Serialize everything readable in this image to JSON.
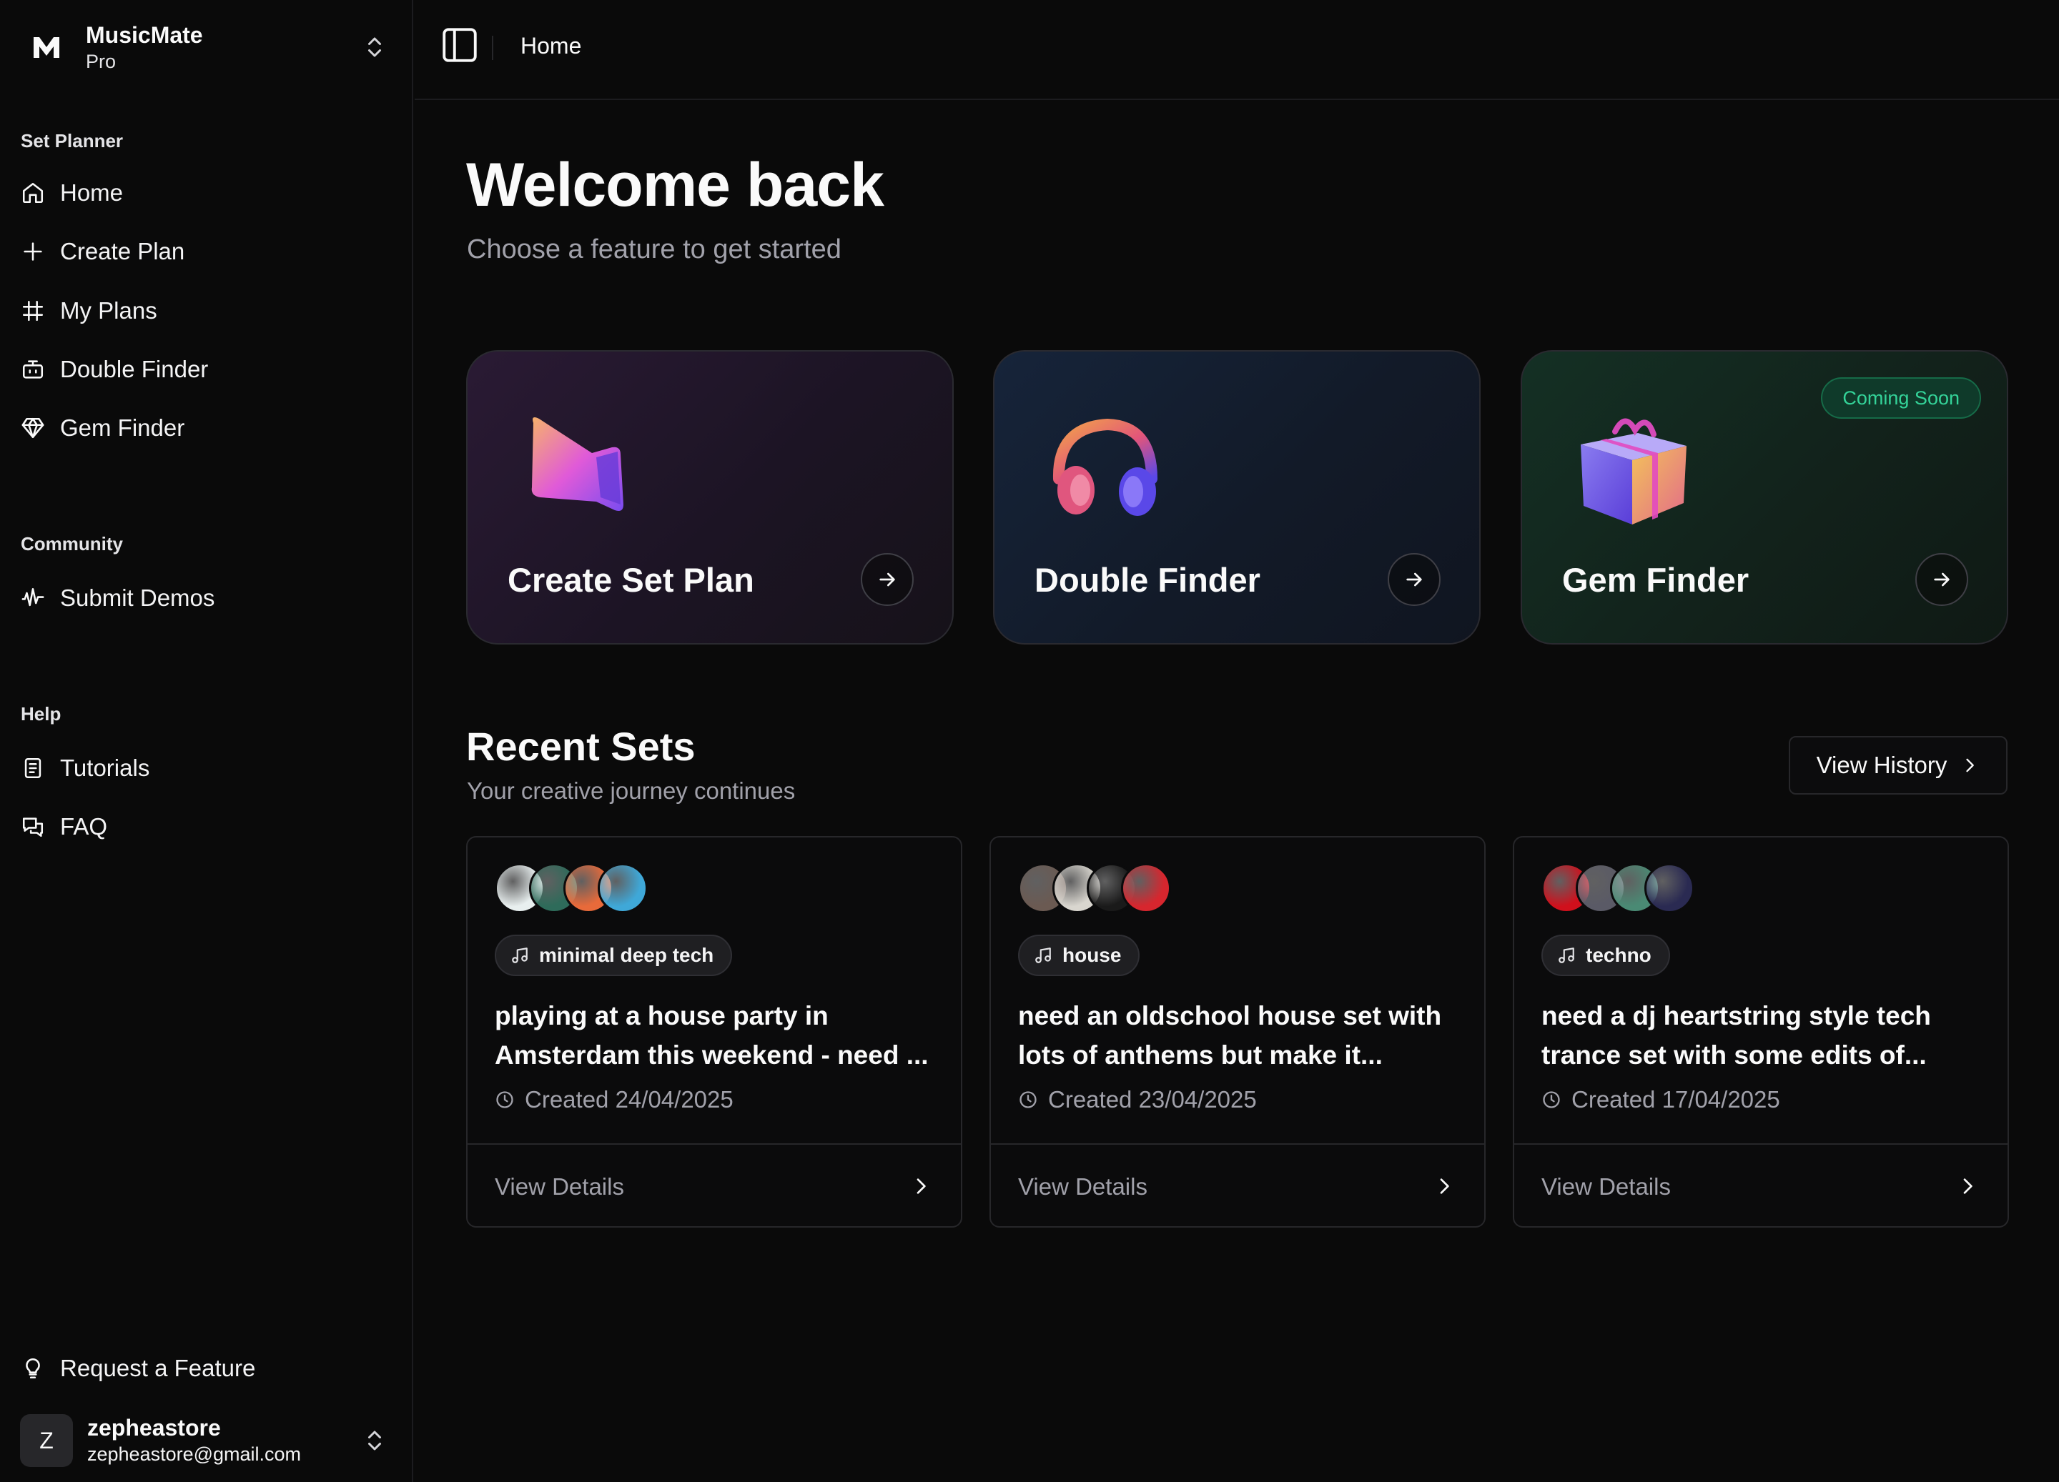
{
  "brand": {
    "name": "MusicMate",
    "plan": "Pro"
  },
  "sidebar": {
    "sections": [
      {
        "label": "Set Planner"
      },
      {
        "label": "Community"
      },
      {
        "label": "Help"
      }
    ],
    "items": [
      {
        "label": "Home",
        "icon": "home-icon"
      },
      {
        "label": "Create Plan",
        "icon": "plus-icon"
      },
      {
        "label": "My Plans",
        "icon": "hash-icon"
      },
      {
        "label": "Double Finder",
        "icon": "bot-icon"
      },
      {
        "label": "Gem Finder",
        "icon": "gem-icon"
      },
      {
        "label": "Submit Demos",
        "icon": "audio-waveform-icon"
      },
      {
        "label": "Tutorials",
        "icon": "book-icon"
      },
      {
        "label": "FAQ",
        "icon": "messages-icon"
      }
    ],
    "request_feature": "Request a Feature",
    "user": {
      "initial": "Z",
      "name": "zepheastore",
      "email": "zepheastore@gmail.com"
    }
  },
  "header": {
    "breadcrumb": "Home"
  },
  "welcome": {
    "title": "Welcome back",
    "subtitle": "Choose a feature to get started"
  },
  "features": [
    {
      "title": "Create Set Plan",
      "accent": "#2a1a34"
    },
    {
      "title": "Double Finder",
      "accent": "#16243a"
    },
    {
      "title": "Gem Finder",
      "badge": "Coming Soon",
      "accent": "#143024"
    }
  ],
  "recent": {
    "title": "Recent Sets",
    "subtitle": "Your creative journey continues",
    "history_label": "View History",
    "sets": [
      {
        "tag": "minimal deep tech",
        "title": "playing at a house party in Amsterdam this weekend - need ...",
        "created": "Created 24/04/2025",
        "details": "View Details",
        "cover_colors": [
          "#e8efef",
          "#2e6b5a",
          "#e86a3a",
          "#3fa8d8"
        ]
      },
      {
        "tag": "house",
        "title": "need an oldschool house set with lots of anthems but make it...",
        "created": "Created 23/04/2025",
        "details": "View Details",
        "cover_colors": [
          "#6b5a52",
          "#d9d6cf",
          "#1a1a1a",
          "#d7262e"
        ]
      },
      {
        "tag": "techno",
        "title": "need a dj heartstring style tech trance set with some edits of...",
        "created": "Created 17/04/2025",
        "details": "View Details",
        "cover_colors": [
          "#d0101c",
          "#5a5a66",
          "#4a8a74",
          "#2a2a52"
        ]
      }
    ]
  }
}
